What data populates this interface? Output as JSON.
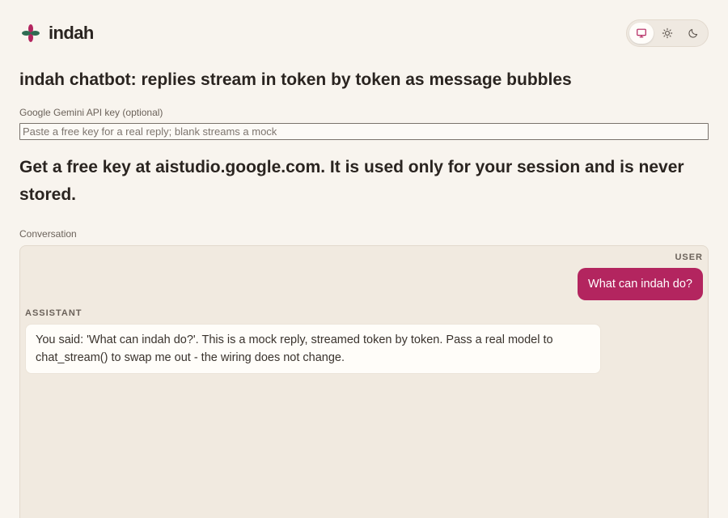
{
  "app": {
    "brand_name": "indah"
  },
  "theme_switch": {
    "options": [
      {
        "icon": "monitor-icon",
        "active": true
      },
      {
        "icon": "sun-icon",
        "active": false
      },
      {
        "icon": "moon-icon",
        "active": false
      }
    ]
  },
  "main": {
    "title": "indah chatbot: replies stream in token by token as message bubbles",
    "api_key_label": "Google Gemini API key (optional)",
    "api_key_value": "",
    "api_key_placeholder": "Paste a free key for a real reply; blank streams a mock",
    "hint": "Get a free key at aistudio.google.com. It is used only for your session and is never stored.",
    "conversation_label": "Conversation"
  },
  "conversation": {
    "messages": [
      {
        "role": "USER",
        "text": "What can indah do?"
      },
      {
        "role": "ASSISTANT",
        "text": "You said: 'What can indah do?'. This is a mock reply, streamed token by token. Pass a real model to chat_stream() to swap me out - the wiring does not change."
      }
    ]
  },
  "colors": {
    "accent": "#b3255f",
    "logo_green": "#2f6b52",
    "background": "#f8f4ee"
  }
}
